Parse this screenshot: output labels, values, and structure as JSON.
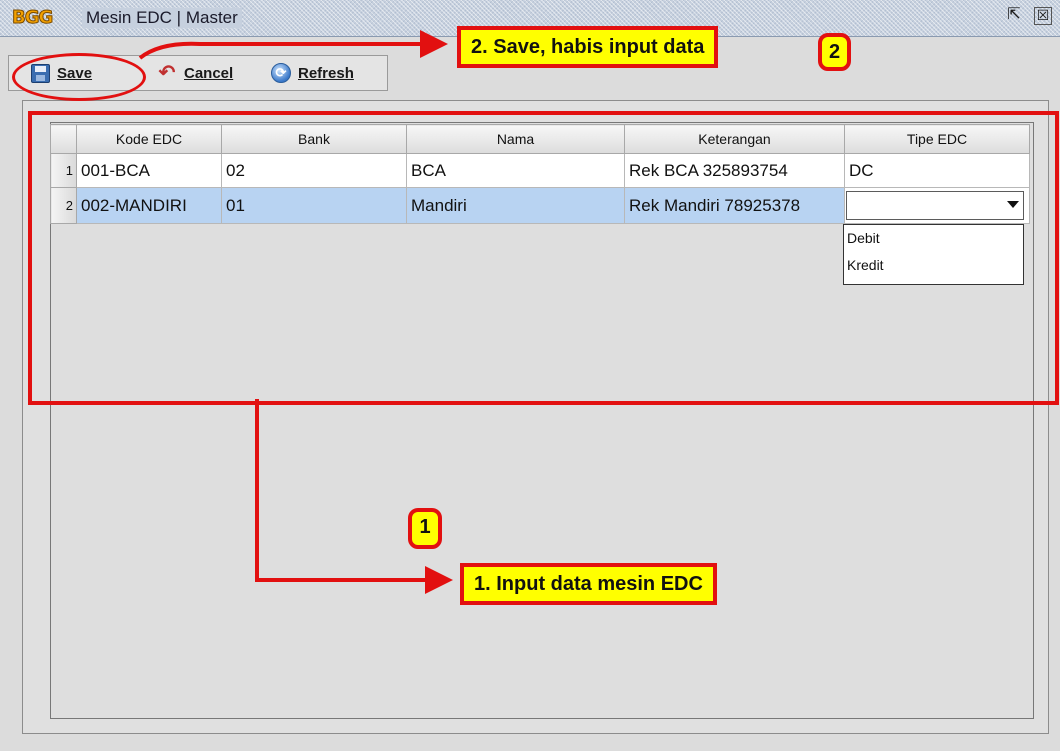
{
  "window": {
    "logo_text": "BGG",
    "title": "Mesin EDC | Master",
    "restore_glyph": "⇱",
    "close_glyph": "☒"
  },
  "toolbar": {
    "save_label": "Save",
    "cancel_label": "Cancel",
    "refresh_label": "Refresh",
    "cancel_glyph": "↶",
    "refresh_glyph": "⟳"
  },
  "grid": {
    "columns": [
      "Kode EDC",
      "Bank",
      "Nama",
      "Keterangan",
      "Tipe EDC"
    ],
    "rows": [
      {
        "num": "1",
        "kode": "001-BCA",
        "bank": "02",
        "nama": "BCA",
        "keterangan": "Rek BCA 325893754",
        "tipe": "DC"
      },
      {
        "num": "2",
        "kode": "002-MANDIRI",
        "bank": "01",
        "nama": "Mandiri",
        "keterangan": "Rek Mandiri 78925378",
        "tipe": ""
      }
    ],
    "selected_row": 2
  },
  "tipe_options": [
    "Debit",
    "Kredit"
  ],
  "annotations": {
    "step2_label": "2. Save, habis input data",
    "step2_num": "2",
    "step1_label": "1. Input data mesin EDC",
    "step1_num": "1"
  },
  "colors": {
    "annotation_red": "#e21010",
    "annotation_yellow": "#ffff00",
    "selected_row": "#b8d3f2"
  }
}
